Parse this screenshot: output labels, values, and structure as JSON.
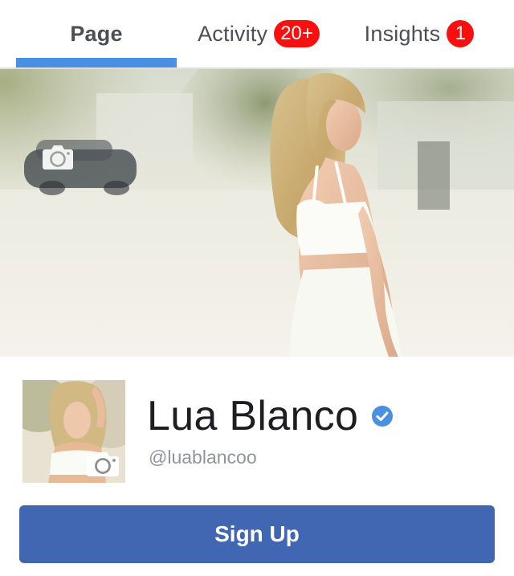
{
  "tabs": [
    {
      "label": "Page",
      "active": true
    },
    {
      "label": "Activity",
      "badge": "20+"
    },
    {
      "label": "Insights",
      "badge": "1"
    }
  ],
  "colors": {
    "active_tab_indicator": "#4a90e2",
    "badge_bg": "#fa0e0e",
    "primary_button": "#4267b2",
    "verified_badge": "#4a90e2",
    "username_text": "#90949c"
  },
  "cover": {
    "image": "cover-photo-woman-in-white-outfit-on-street",
    "camera_icon": "camera-icon"
  },
  "profile": {
    "image": "profile-photo-woman-blonde-hair",
    "camera_icon": "camera-icon",
    "name": "Lua Blanco",
    "verified": true,
    "verified_icon": "verified-check-icon",
    "username": "@luablancoo"
  },
  "cta": {
    "label": "Sign Up"
  }
}
